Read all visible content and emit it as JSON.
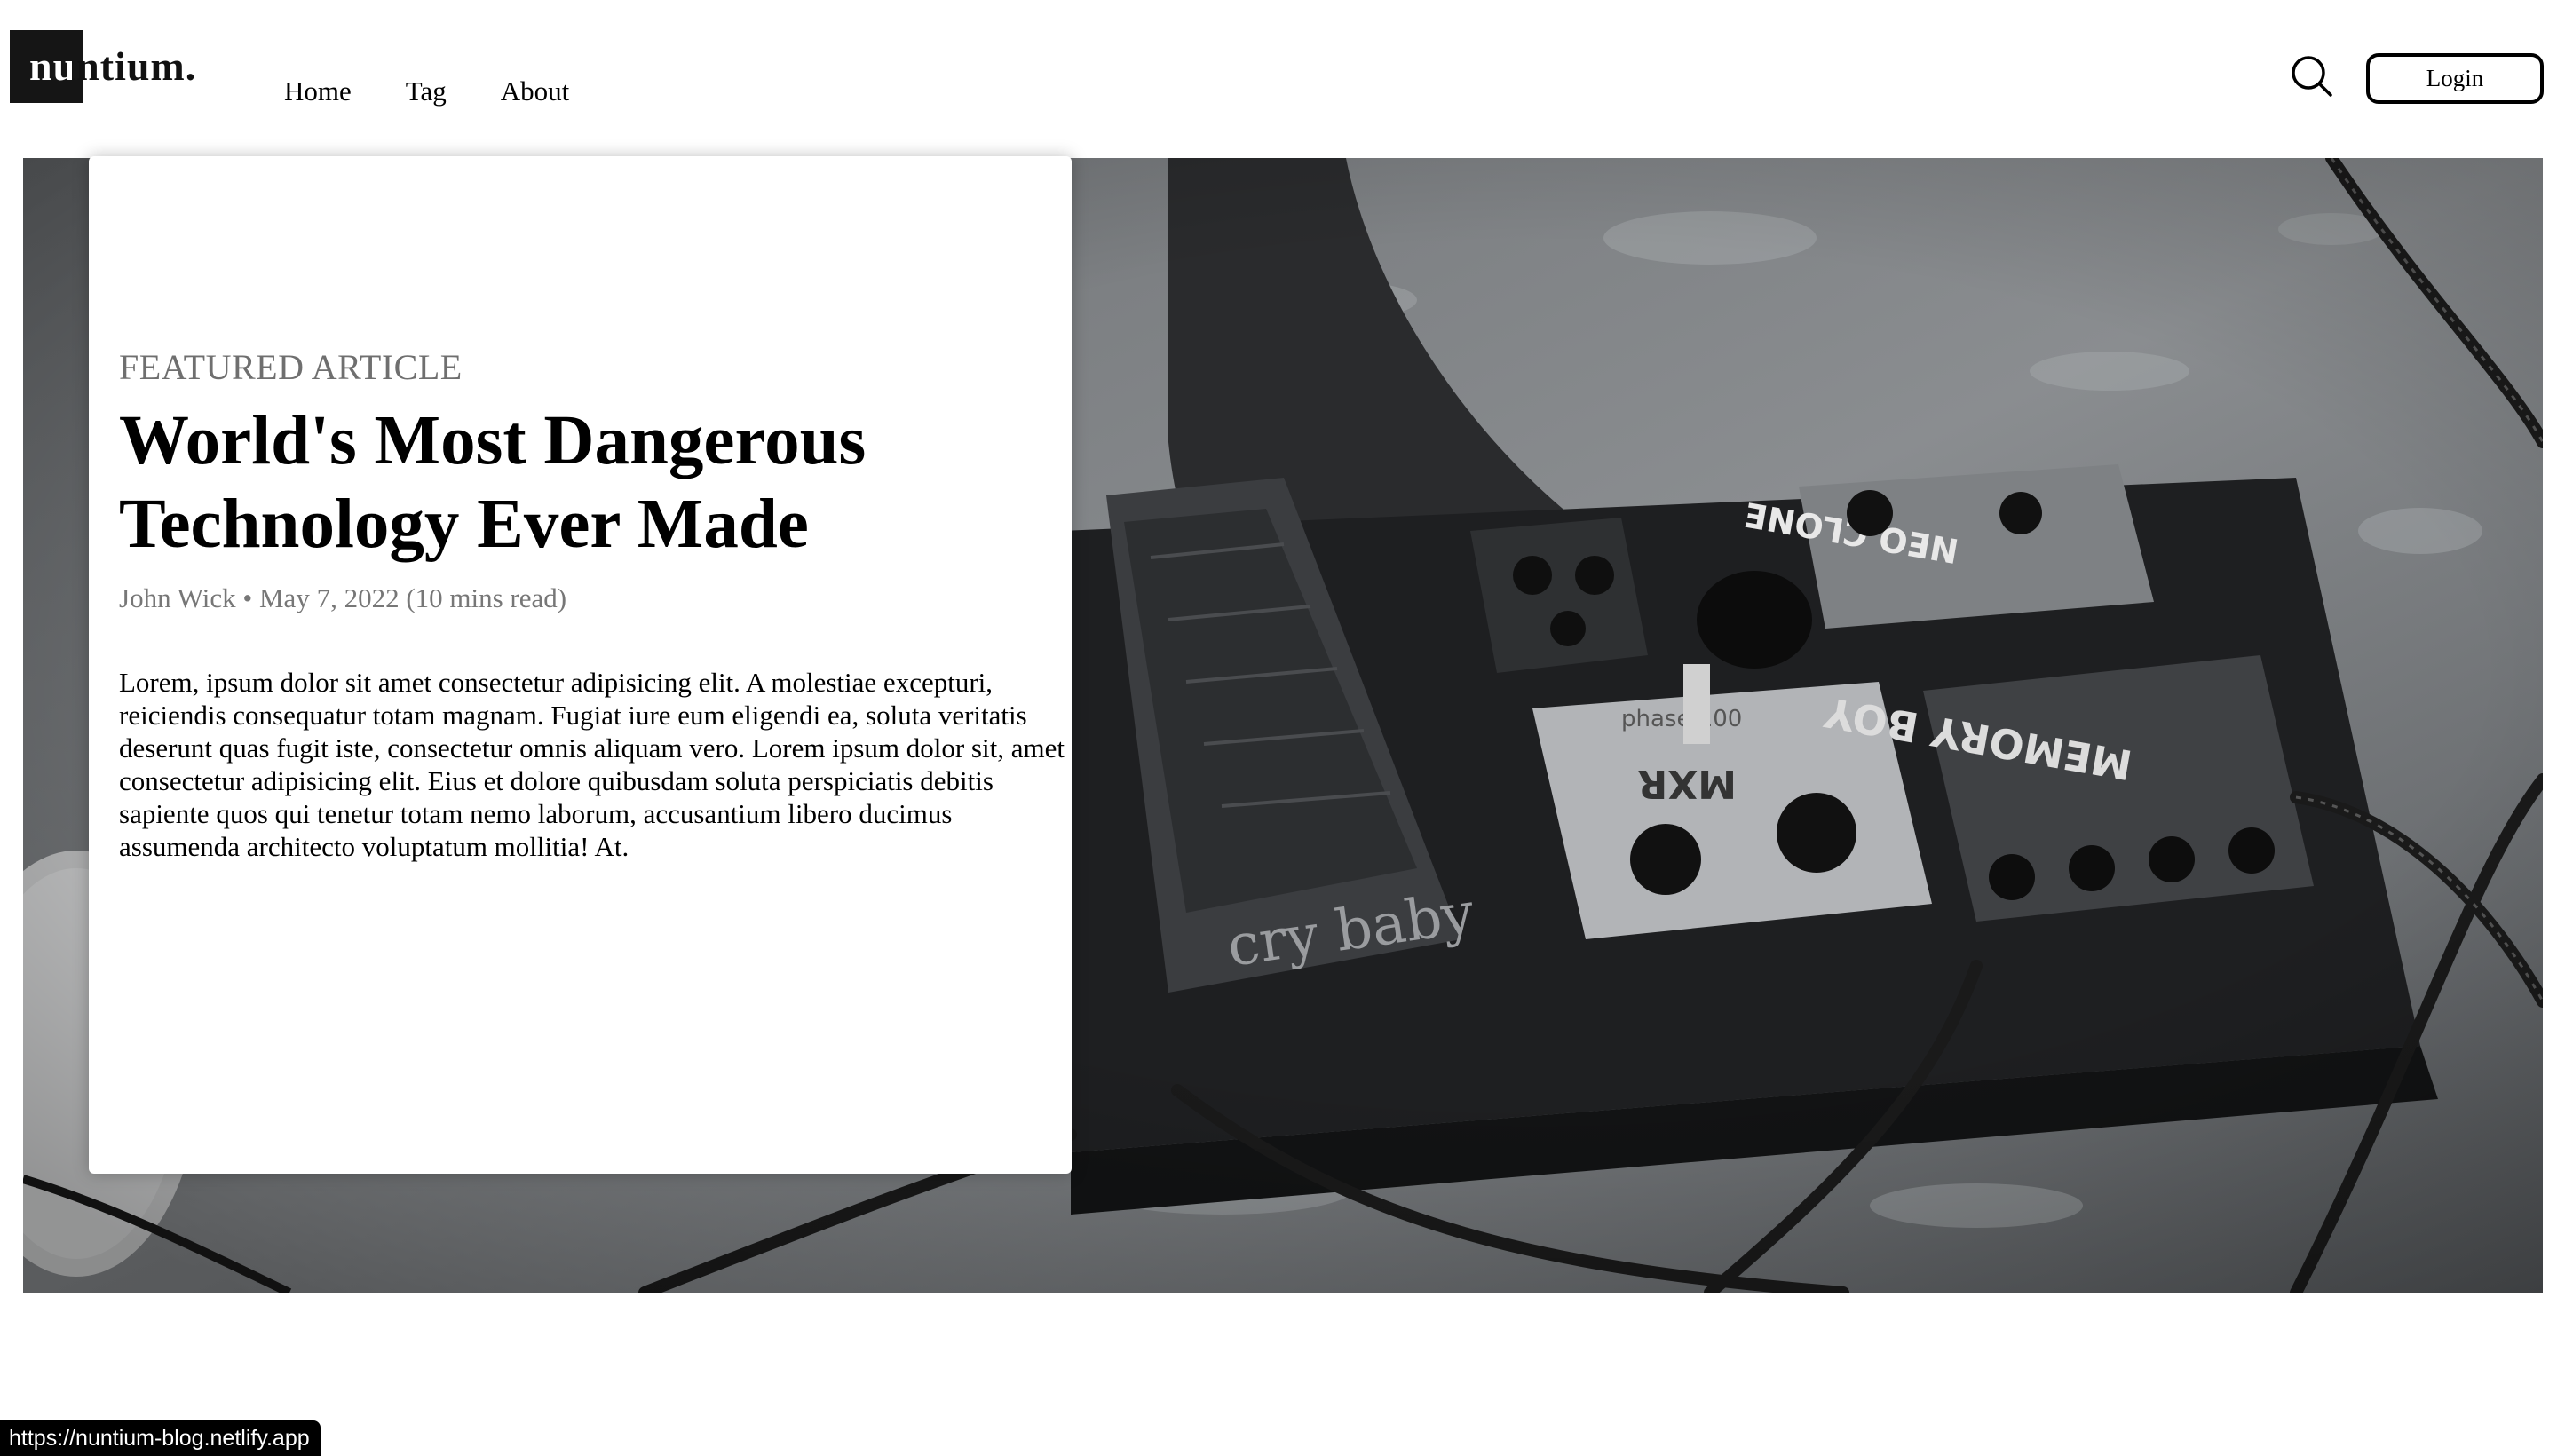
{
  "header": {
    "logo_text": "nuntium.",
    "nav": [
      {
        "label": "Home"
      },
      {
        "label": "Tag"
      },
      {
        "label": "About"
      }
    ],
    "search_icon": "search-icon",
    "login_label": "Login"
  },
  "featured": {
    "eyebrow": "FEATURED ARTICLE",
    "title": "World's Most Dangerous Technology Ever Made",
    "meta": "John Wick • May 7, 2022 (10 mins read)",
    "excerpt": "Lorem, ipsum dolor sit amet consectetur adipisicing elit. A molestiae excepturi, reiciendis consequatur totam magnam. Fugiat iure eum eligendi ea, soluta veritatis deserunt quas fugit iste, consectetur omnis aliquam vero. Lorem ipsum dolor sit, amet consectetur adipisicing elit. Eius et dolore quibusdam soluta perspiciatis debitis sapiente quos qui tenetur totam nemo laborum, accusantium libero ducimus assumenda architecto voluptatum mollitia! At.",
    "hero_image": "guitar-pedalboard-photo",
    "pedal_labels": [
      "cry baby",
      "MXR",
      "phase 100",
      "MEMORY BOY",
      "NEO CLONE"
    ]
  },
  "status_bar": {
    "url": "https://nuntium-blog.netlify.app"
  },
  "colors": {
    "accent": "#000000",
    "logo_box": "#151515",
    "muted_text": "#6f6f6f"
  }
}
